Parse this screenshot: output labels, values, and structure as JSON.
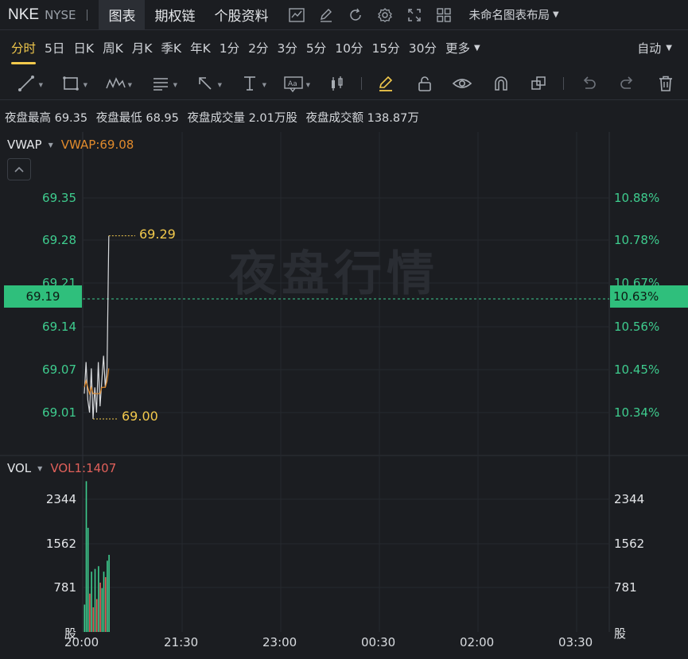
{
  "header": {
    "ticker": "NKE",
    "exchange": "NYSE",
    "tabs": [
      "图表",
      "期权链",
      "个股资料"
    ],
    "active_tab": 0,
    "layout_name": "未命名图表布局"
  },
  "periods": {
    "items": [
      "分时",
      "5日",
      "日K",
      "周K",
      "月K",
      "季K",
      "年K",
      "1分",
      "2分",
      "3分",
      "5分",
      "10分",
      "15分",
      "30分",
      "更多"
    ],
    "active": 0,
    "scale_mode": "自动"
  },
  "info": {
    "high_label": "夜盘最高",
    "high_value": "69.35",
    "low_label": "夜盘最低",
    "low_value": "68.95",
    "vol_label": "夜盘成交量",
    "vol_value": "2.01万股",
    "amt_label": "夜盘成交额",
    "amt_value": "138.87万"
  },
  "main_pane": {
    "indicator_name": "VWAP",
    "indicator_value": "VWAP:69.08",
    "watermark": "夜盘行情",
    "price_ticks": [
      "69.35",
      "69.28",
      "69.21",
      "69.14",
      "69.07",
      "69.01"
    ],
    "pct_ticks": [
      "10.88%",
      "10.78%",
      "10.67%",
      "10.56%",
      "10.45%",
      "10.34%"
    ],
    "current_price": "69.19",
    "current_pct": "10.63%",
    "high_mark": "69.29",
    "low_mark": "69.00"
  },
  "vol_pane": {
    "indicator_name": "VOL",
    "indicator_value": "VOL1:1407",
    "ticks": [
      "2344",
      "1562",
      "781"
    ],
    "unit": "股"
  },
  "time_axis": [
    "20:00",
    "21:30",
    "23:00",
    "00:30",
    "02:00",
    "03:30"
  ],
  "colors": {
    "up": "#3ecc8e",
    "down": "#e0605a",
    "accent": "#f2c94c",
    "vwap": "#e08a2c",
    "price_line": "#d8dadd",
    "vol_label": "#e0605a"
  },
  "chart_data": {
    "type": "line",
    "price_range": [
      68.97,
      69.38
    ],
    "price": [
      69.04,
      69.09,
      69.03,
      69.01,
      69.08,
      69.0,
      69.05,
      69.01,
      69.09,
      69.02,
      69.06,
      69.1,
      69.05,
      69.08,
      69.29
    ],
    "vwap": [
      69.05,
      69.06,
      69.05,
      69.04,
      69.05,
      69.04,
      69.04,
      69.04,
      69.04,
      69.04,
      69.05,
      69.05,
      69.05,
      69.06,
      69.08
    ],
    "volume": [
      500,
      2750,
      1900,
      700,
      1100,
      450,
      1150,
      600,
      1200,
      900,
      800,
      1100,
      1000,
      1300,
      1407
    ],
    "volume_up": [
      true,
      true,
      true,
      false,
      true,
      false,
      true,
      false,
      true,
      false,
      true,
      true,
      false,
      true,
      true
    ],
    "volume_range": [
      0,
      2900
    ]
  }
}
